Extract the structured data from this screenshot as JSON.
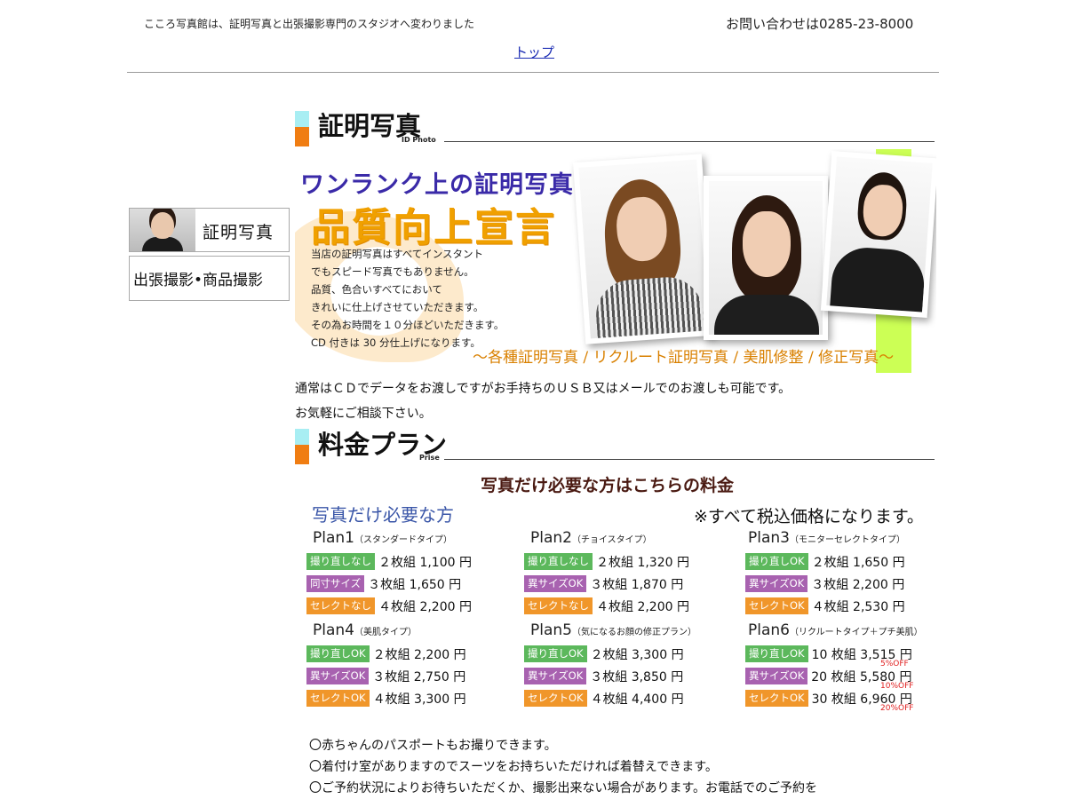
{
  "header": {
    "tagline": "こころ写真館は、証明写真と出張撮影専門のスタジオへ変わりました",
    "contact": "お問い合わせは0285-23-8000",
    "top_link": "トップ"
  },
  "sidebar": {
    "items": [
      {
        "label": "証明写真"
      },
      {
        "label": "出張撮影•商品撮影"
      }
    ]
  },
  "section_id": {
    "title": "証明写真",
    "subtitle": "ID Photo"
  },
  "banner": {
    "title1": "ワンランク上の証明写真",
    "title2": "品質向上宣言",
    "desc": [
      "当店の証明写真はすべてインスタント",
      "でもスピード写真でもありません。",
      "品質、色合いすべてにおいて",
      "きれいに仕上げさせていただきます。",
      "その為お時間を１０分ほどいただきます。",
      "CD 付きは 30 分仕上げになります。"
    ],
    "footer": "～各種証明写真 / リクルート証明写真 / 美肌修整 / 修正写真～"
  },
  "notes": {
    "line1": "通常はＣＤでデータをお渡しですがお手持ちのＵＳＢ又はメールでのお渡しも可能です。",
    "line2": "お気軽にご相談下さい。"
  },
  "section_price": {
    "title": "料金プラン",
    "subtitle": "Prise"
  },
  "pricing": {
    "heading": "写真だけ必要な方はこちらの料金",
    "subheading": "写真だけ必要な方",
    "tax_note": "※すべて税込価格になります。",
    "plans": [
      {
        "name": "Plan1",
        "type": "（スタンダードタイプ）",
        "rows": [
          {
            "badge": "撮り直しなし",
            "color": "#5cb85c",
            "text": "２枚組 1,100 円"
          },
          {
            "badge": "同寸サイズ",
            "color": "#a862b0",
            "text": "３枚組 1,650 円"
          },
          {
            "badge": "セレクトなし",
            "color": "#f0962a",
            "text": "４枚組 2,200 円"
          }
        ]
      },
      {
        "name": "Plan2",
        "type": "（チョイスタイプ）",
        "rows": [
          {
            "badge": "撮り直しなし",
            "color": "#5cb85c",
            "text": "２枚組 1,320 円"
          },
          {
            "badge": "異サイズOK",
            "color": "#a862b0",
            "text": "３枚組 1,870 円"
          },
          {
            "badge": "セレクトなし",
            "color": "#f0962a",
            "text": "４枚組 2,200 円"
          }
        ]
      },
      {
        "name": "Plan3",
        "type": "（モニターセレクトタイプ）",
        "rows": [
          {
            "badge": "撮り直しOK",
            "color": "#5cb85c",
            "text": "２枚組 1,650 円"
          },
          {
            "badge": "異サイズOK",
            "color": "#a862b0",
            "text": "３枚組 2,200 円"
          },
          {
            "badge": "セレクトOK",
            "color": "#f0962a",
            "text": "４枚組 2,530 円"
          }
        ]
      },
      {
        "name": "Plan4",
        "type": "（美肌タイプ）",
        "rows": [
          {
            "badge": "撮り直しOK",
            "color": "#5cb85c",
            "text": "２枚組 2,200 円"
          },
          {
            "badge": "異サイズOK",
            "color": "#a862b0",
            "text": "３枚組 2,750 円"
          },
          {
            "badge": "セレクトOK",
            "color": "#f0962a",
            "text": "４枚組 3,300 円"
          }
        ]
      },
      {
        "name": "Plan5",
        "type": "（気になるお顔の修正プラン）",
        "rows": [
          {
            "badge": "撮り直しOK",
            "color": "#5cb85c",
            "text": "２枚組 3,300 円"
          },
          {
            "badge": "異サイズOK",
            "color": "#a862b0",
            "text": "３枚組 3,850 円"
          },
          {
            "badge": "セレクトOK",
            "color": "#f0962a",
            "text": "４枚組 4,400 円"
          }
        ]
      },
      {
        "name": "Plan6",
        "type": "（リクルートタイプ＋プチ美肌）",
        "rows": [
          {
            "badge": "撮り直しOK",
            "color": "#5cb85c",
            "text": "10 枚組 3,515 円",
            "discount": "5%OFF"
          },
          {
            "badge": "異サイズOK",
            "color": "#a862b0",
            "text": "20 枚組 5,580 円",
            "discount": "10%OFF"
          },
          {
            "badge": "セレクトOK",
            "color": "#f0962a",
            "text": "30 枚組 6,960 円",
            "discount": "20%OFF"
          }
        ]
      }
    ]
  },
  "bullets": [
    "〇赤ちゃんのパスポートもお撮りできます。",
    "〇着付け室がありますのでスーツをお持ちいただければ着替えできます。",
    "〇ご予約状況によりお待ちいただくか、撮影出来ない場合があります。お電話でのご予約を"
  ]
}
